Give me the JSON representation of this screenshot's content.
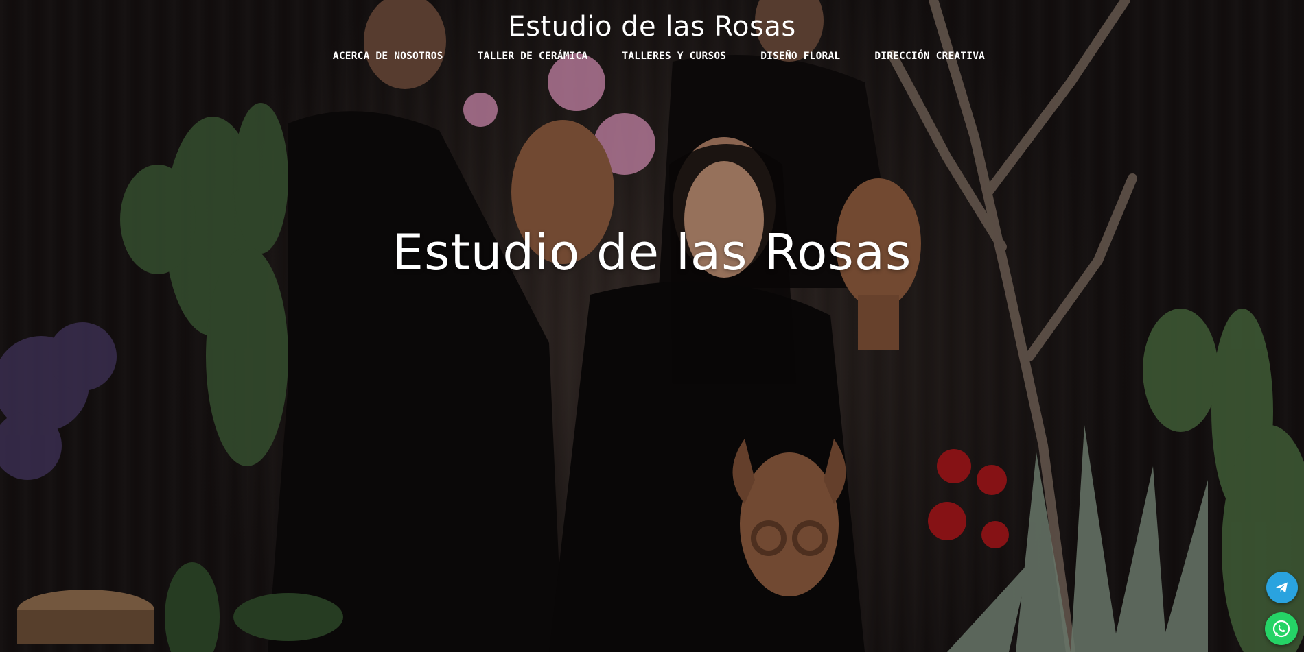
{
  "site": {
    "title": "Estudio de las Rosas"
  },
  "nav": {
    "items": [
      {
        "label": "ACERCA DE NOSOTROS"
      },
      {
        "label": "TALLER DE CERÁMICA"
      },
      {
        "label": "TALLERES Y CURSOS"
      },
      {
        "label": "DISEÑO FLORAL"
      },
      {
        "label": "DIRECCIÓN CREATIVA"
      }
    ]
  },
  "hero": {
    "title": "Estudio de las Rosas"
  },
  "floating": {
    "telegram_icon": "telegram-icon",
    "whatsapp_icon": "whatsapp-icon",
    "telegram_color": "#2AA3DF",
    "whatsapp_color": "#25D366"
  }
}
